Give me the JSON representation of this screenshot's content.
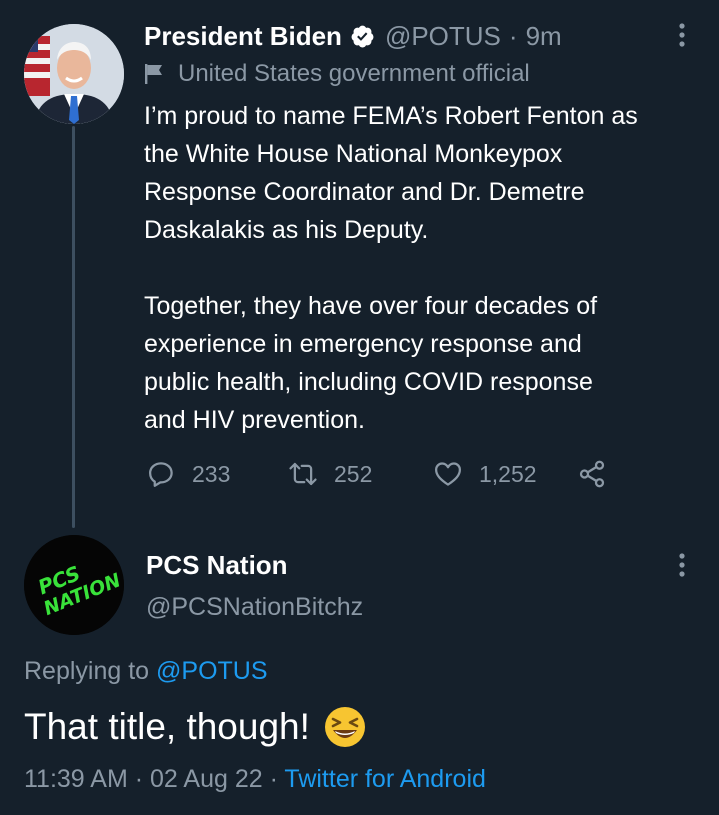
{
  "tweet1": {
    "author_name": "President Biden",
    "handle": "@POTUS",
    "separator": "·",
    "time_ago": "9m",
    "label": "United States government official",
    "paragraphs": [
      "I’m proud to name FEMA’s Robert Fenton as\nthe White House National Monkeypox\nResponse Coordinator and Dr. Demetre\nDaskalakis as his Deputy.",
      "Together, they have over four decades of\nexperience in emergency response and\npublic health, including COVID response\nand HIV prevention."
    ],
    "replies": "233",
    "retweets": "252",
    "likes": "1,252"
  },
  "tweet2": {
    "author_name": "PCS Nation",
    "handle": "@PCSNationBitchz",
    "avatar_text_line1": "PCS",
    "avatar_text_line2": "NATION",
    "replying_prefix": "Replying to",
    "replying_handle": "@POTUS",
    "text": "That title, though!",
    "time": "11:39 AM",
    "separator": "·",
    "date": "02 Aug 22",
    "source": "Twitter for Android"
  },
  "colors": {
    "background": "#15202b",
    "text_primary": "#ffffff",
    "text_secondary": "#8b98a5",
    "link": "#1d9bf0",
    "avatar_logo_green": "#39e23a"
  },
  "icons": [
    "verified-badge-icon",
    "flag-icon",
    "more-options-icon",
    "reply-icon",
    "retweet-icon",
    "like-icon",
    "share-icon",
    "laughing-emoji"
  ]
}
